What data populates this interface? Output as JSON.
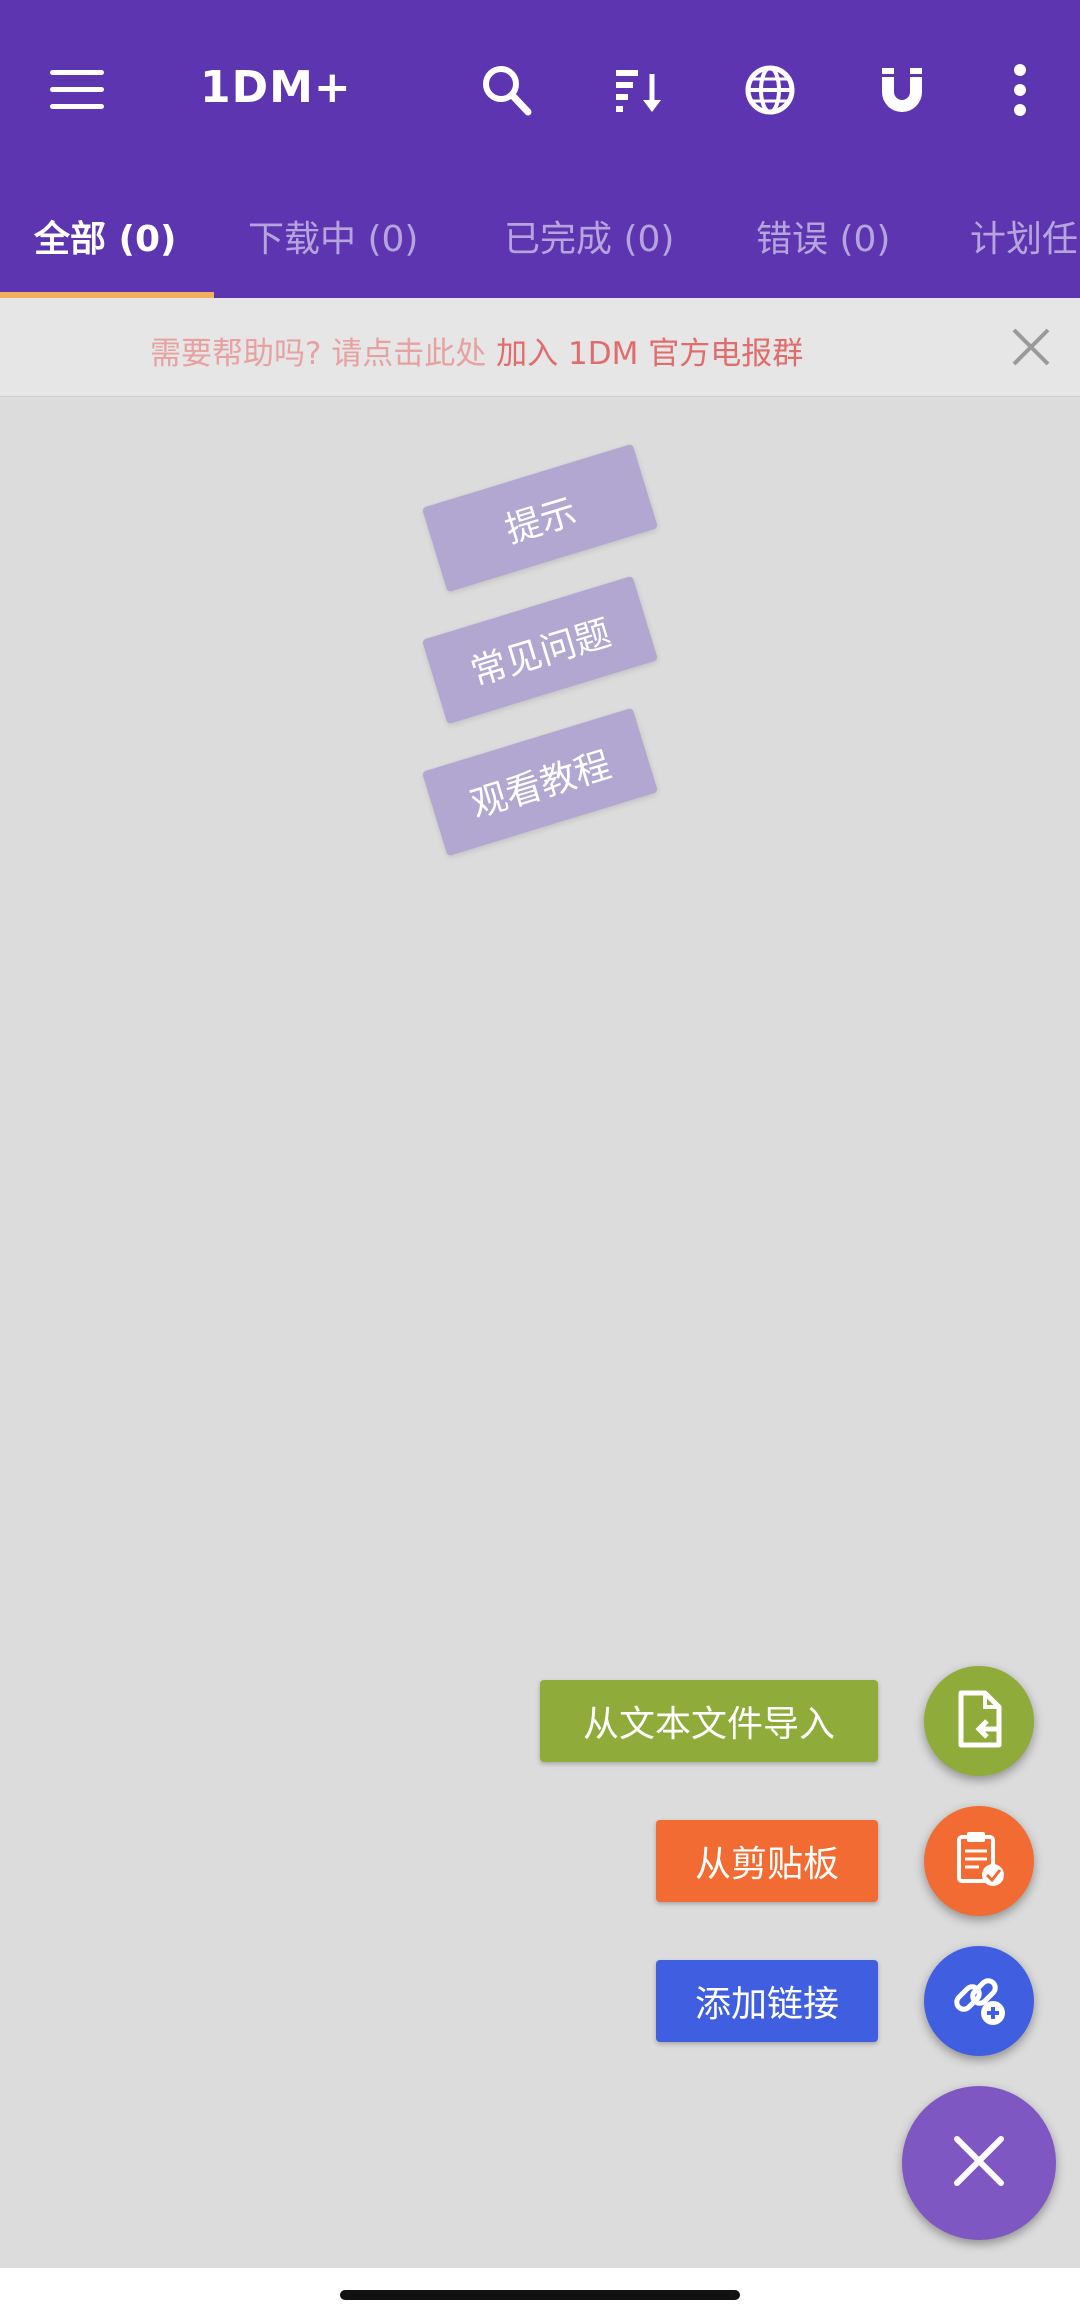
{
  "app": {
    "title": "1DM+"
  },
  "appbar": {
    "icons": [
      "menu-icon",
      "search-icon",
      "sort-icon",
      "browser-icon",
      "magnet-icon",
      "more-icon"
    ]
  },
  "tabs": [
    {
      "label": "全部 (0)",
      "active": true
    },
    {
      "label": "下载中 (0)",
      "active": false
    },
    {
      "label": "已完成 (0)",
      "active": false
    },
    {
      "label": "错误 (0)",
      "active": false
    },
    {
      "label": "计划任",
      "active": false
    }
  ],
  "banner": {
    "prefix": "需要帮助吗? 请点击此处 ",
    "link": "加入 1DM 官方电报群"
  },
  "hints": [
    {
      "label": "提示"
    },
    {
      "label": "常见问题"
    },
    {
      "label": "观看教程"
    }
  ],
  "fab_actions": [
    {
      "label": "从文本文件导入",
      "color": "#8fab3a",
      "icon": "import-file-icon"
    },
    {
      "label": "从剪贴板",
      "color": "#f26b32",
      "icon": "clipboard-icon"
    },
    {
      "label": "添加链接",
      "color": "#3f5fe0",
      "icon": "add-link-icon"
    }
  ],
  "colors": {
    "primary": "#5e35b1",
    "accent_fab": "#7e57c2",
    "tab_indicator": "#f0b060",
    "banner_link": "#e06d6d"
  }
}
